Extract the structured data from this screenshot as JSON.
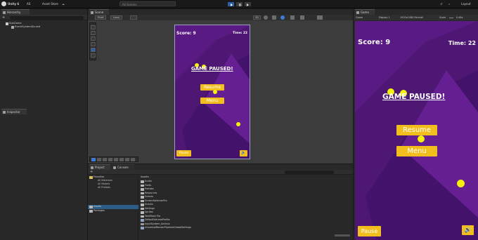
{
  "topbar": {
    "app_title": "Unity 6",
    "account_menu": "AS",
    "asset_store": "Asset Store",
    "search_hint": "All Scenes",
    "layout_label": "Layout"
  },
  "hierarchy": {
    "tab_label": "Hierarchy",
    "items": [
      "SubGame",
      "EventSystemDo.sed"
    ]
  },
  "inspector": {
    "tab_label": "Inspector"
  },
  "scene": {
    "tab_label": "Scene",
    "shading_mode": "Pivot",
    "space_mode": "Local",
    "dim_2d": "2D"
  },
  "project": {
    "tabs": [
      "Project",
      "Console"
    ],
    "favorites_label": "Favorites",
    "favorites": [
      "All Materials",
      "All Models",
      "All Prefabs"
    ],
    "roots": [
      "Assets",
      "Packages"
    ],
    "breadcrumb": "Assets",
    "folders": [
      "Audio",
      "Fonts",
      "Prefabs",
      "Resources",
      "Scenes",
      "ScreenSwitcherPro",
      "Scripts",
      "Settings",
      "Sprites",
      "TextMesh Pro"
    ],
    "files": [
      "DefaultVolumeProfile",
      "InputSystem_Actions",
      "UniversalRenderPipelineGlobalSettings"
    ]
  },
  "game_view": {
    "tab_label": "Game",
    "display_label": "Game",
    "display_select": "Display 1",
    "resolution": "1920x1080 Portrait",
    "scale_label": "Scale",
    "scale_value": "0.48x"
  },
  "game_ui": {
    "score": "Score: 9",
    "time": "Time: 22",
    "paused_text": "GAME PAUSED!",
    "resume_label": "Resume",
    "menu_label": "Menu",
    "pause_label": "Pause"
  },
  "colors": {
    "editor_bg": "#191919",
    "panel_bg": "#282828",
    "game_purple": "#5a1a83",
    "button_yellow": "#f2be1e",
    "ball_yellow": "#f4f10c",
    "play_blue": "#2f5ea6"
  }
}
